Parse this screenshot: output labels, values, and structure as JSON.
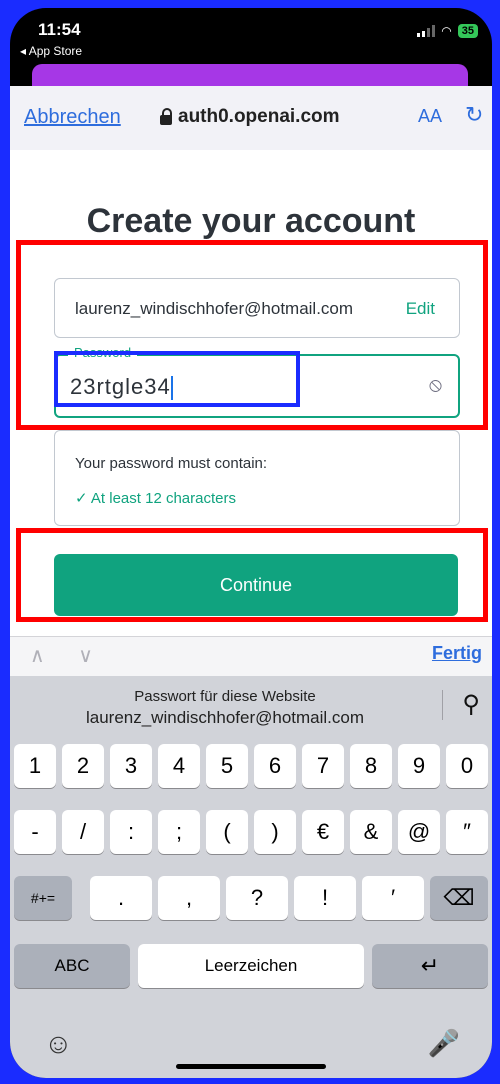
{
  "status": {
    "time": "11:54",
    "back_app": "◂ App Store",
    "battery": "35"
  },
  "browser": {
    "cancel": "Abbrechen",
    "url": "auth0.openai.com",
    "text_size": "AA",
    "reload": "↻"
  },
  "form": {
    "title": "Create your account",
    "email": "laurenz_windischhofer@hotmail.com",
    "edit": "Edit",
    "password_label": "Password",
    "password_value": "23rtgle34",
    "rules_title": "Your password must contain:",
    "rule_1": "✓   At least 12 characters",
    "continue": "Continue"
  },
  "accessory": {
    "arrows": "∧ ∨",
    "done": "Fertig"
  },
  "keyboard": {
    "suggest_top": "Passwort für diese Website",
    "suggest_bottom": "laurenz_windischhofer@hotmail.com",
    "row1": [
      "1",
      "2",
      "3",
      "4",
      "5",
      "6",
      "7",
      "8",
      "9",
      "0"
    ],
    "row2": [
      "-",
      "/",
      ":",
      ";",
      "(",
      ")",
      "€",
      "&",
      "@",
      "″"
    ],
    "row3": [
      "#+=",
      ".",
      ",",
      "?",
      "!",
      "′",
      "⌫"
    ],
    "row4": [
      "ABC",
      "Leerzeichen",
      "↵"
    ],
    "emoji": "☺",
    "mic": "🎤"
  },
  "colors": {
    "accent": "#10a37f",
    "link": "#2e6ddd",
    "highlight_red": "#ff0000",
    "highlight_blue": "#1a2cff"
  }
}
